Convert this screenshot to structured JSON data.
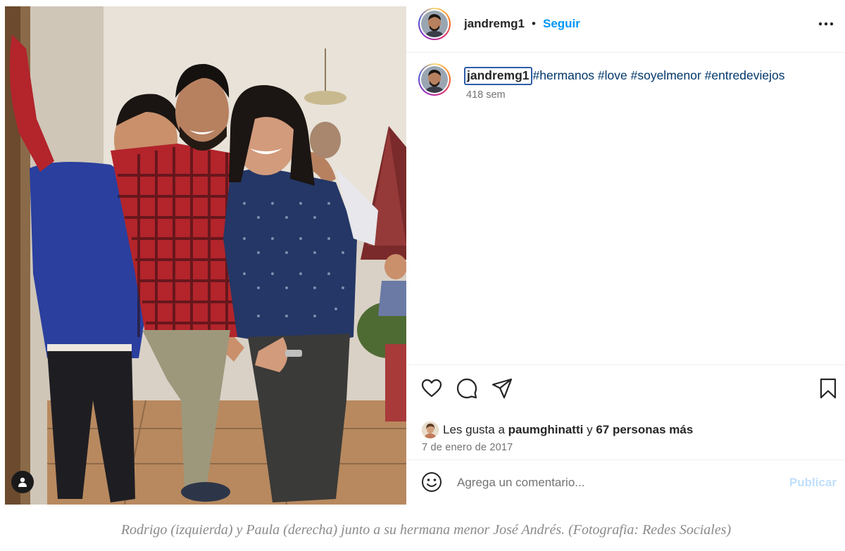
{
  "post": {
    "username": "jandremg1",
    "separator": "•",
    "follow_label": "Seguir",
    "more_icon": "more-horizontal-icon",
    "caption_hashtags": "#hermanos #love #soyelmenor #entredeviejos",
    "caption_time": "418 sem",
    "likes_prefix": "Les gusta a",
    "likes_user": "paumghinatti",
    "likes_mid": "y",
    "likes_count": "67 personas más",
    "date": "7 de enero de 2017",
    "comment_placeholder": "Agrega un comentario...",
    "publish_label": "Publicar",
    "icons": {
      "like": "heart-icon",
      "comment": "comment-icon",
      "share": "send-icon",
      "save": "bookmark-icon",
      "emoji": "emoji-icon",
      "tagged": "user-tag-icon"
    },
    "colors": {
      "link": "#0095f6",
      "hashtag": "#00376b",
      "publish_disabled": "#c0dffd",
      "muted": "#737373"
    }
  },
  "figure_caption": "Rodrigo (izquierda) y Paula (derecha) junto a su hermana menor José Andrés. (Fotografia: Redes Sociales)"
}
